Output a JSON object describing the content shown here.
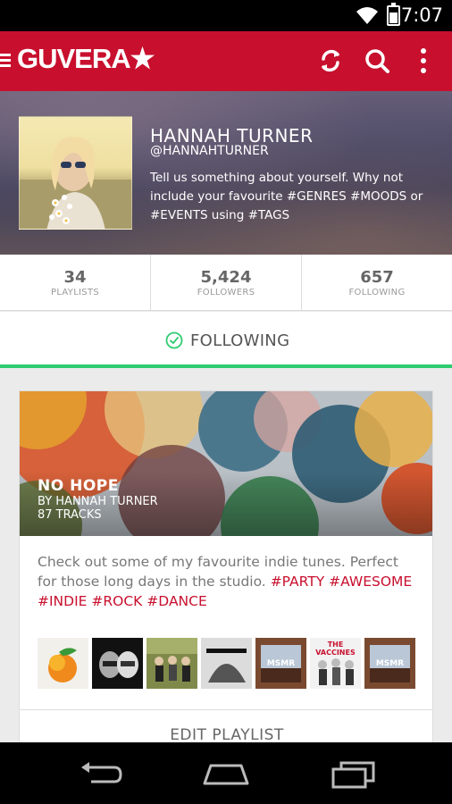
{
  "status_bar": {
    "time": "7:07"
  },
  "app_bar": {
    "logo": "GUVERA★"
  },
  "profile": {
    "name": "HANNAH TURNER",
    "handle": "@HANNAHTURNER",
    "bio": "Tell us something about yourself. Why not include your favourite #GENRES #MOODS or #EVENTS using #TAGS"
  },
  "stats": [
    {
      "value": "34",
      "label": "PLAYLISTS"
    },
    {
      "value": "5,424",
      "label": "FOLLOWERS"
    },
    {
      "value": "657",
      "label": "FOLLOWING"
    }
  ],
  "follow": {
    "label": "FOLLOWING",
    "color": "#2ecc71"
  },
  "playlist": {
    "title": "NO HOPE",
    "by": "BY HANNAH TURNER",
    "tracks": "87 TRACKS",
    "description": "Check out some of my favourite indie tunes. Perfect for those long days in the studio.",
    "tags": [
      "#PARTY",
      "#AWESOME",
      "#INDIE",
      "#ROCK",
      "#DANCE"
    ],
    "thumb_texts": [
      "THE VACCINES",
      "MSMR",
      "MSMR"
    ],
    "edit_label": "EDIT PLAYLIST"
  },
  "colors": {
    "brand": "#c8102e",
    "accent": "#2ecc71"
  }
}
